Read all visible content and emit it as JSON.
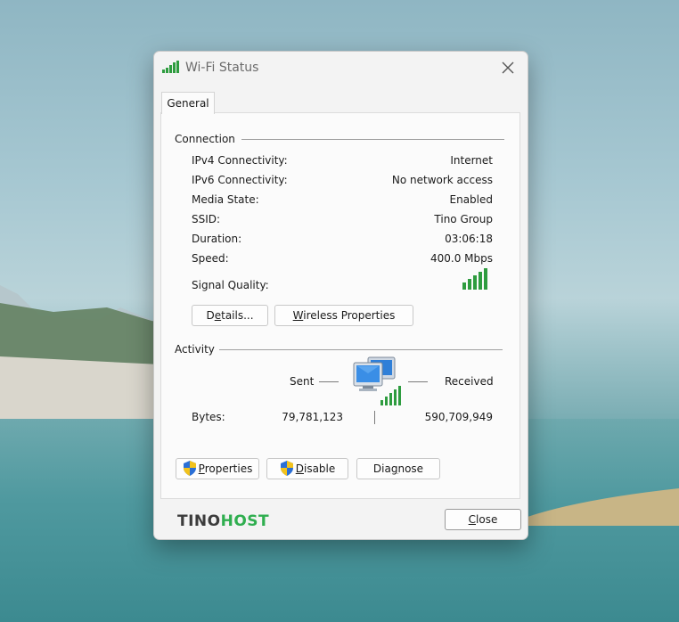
{
  "window": {
    "title": "Wi-Fi Status",
    "icon": "wifi-signal-icon",
    "close_glyph": "✕"
  },
  "tabs": [
    {
      "label": "General",
      "active": true
    }
  ],
  "connection": {
    "section_label": "Connection",
    "rows": [
      {
        "label": "IPv4 Connectivity:",
        "value": "Internet"
      },
      {
        "label": "IPv6 Connectivity:",
        "value": "No network access"
      },
      {
        "label": "Media State:",
        "value": "Enabled"
      },
      {
        "label": "SSID:",
        "value": "Tino Group"
      },
      {
        "label": "Duration:",
        "value": "03:06:18"
      },
      {
        "label": "Speed:",
        "value": "400.0 Mbps"
      }
    ],
    "signal_quality_label": "Signal Quality:",
    "signal_bars_lit": 5,
    "signal_bars_total": 5,
    "details_button": {
      "pre": "D",
      "ul": "e",
      "post": "tails..."
    },
    "wireless_button": {
      "pre": "",
      "ul": "W",
      "post": "ireless Properties"
    }
  },
  "activity": {
    "section_label": "Activity",
    "sent_label": "Sent",
    "received_label": "Received",
    "bytes_label": "Bytes:",
    "sent_bytes": "79,781,123",
    "received_bytes": "590,709,949",
    "icon": "network-computers-icon"
  },
  "buttons": {
    "properties": {
      "pre": "",
      "ul": "P",
      "post": "roperties"
    },
    "disable": {
      "pre": "",
      "ul": "D",
      "post": "isable"
    },
    "diagnose": {
      "pre": "Dia",
      "ul": "g",
      "post": "nose"
    },
    "close": {
      "pre": "",
      "ul": "C",
      "post": "lose"
    }
  },
  "branding": {
    "logo_left": "TINO",
    "logo_right": "HOST"
  },
  "colors": {
    "signal_green": "#2e9c3f",
    "logo_green": "#2fae4f",
    "shield_blue": "#2a6fd6",
    "shield_yellow": "#f2c21b"
  }
}
